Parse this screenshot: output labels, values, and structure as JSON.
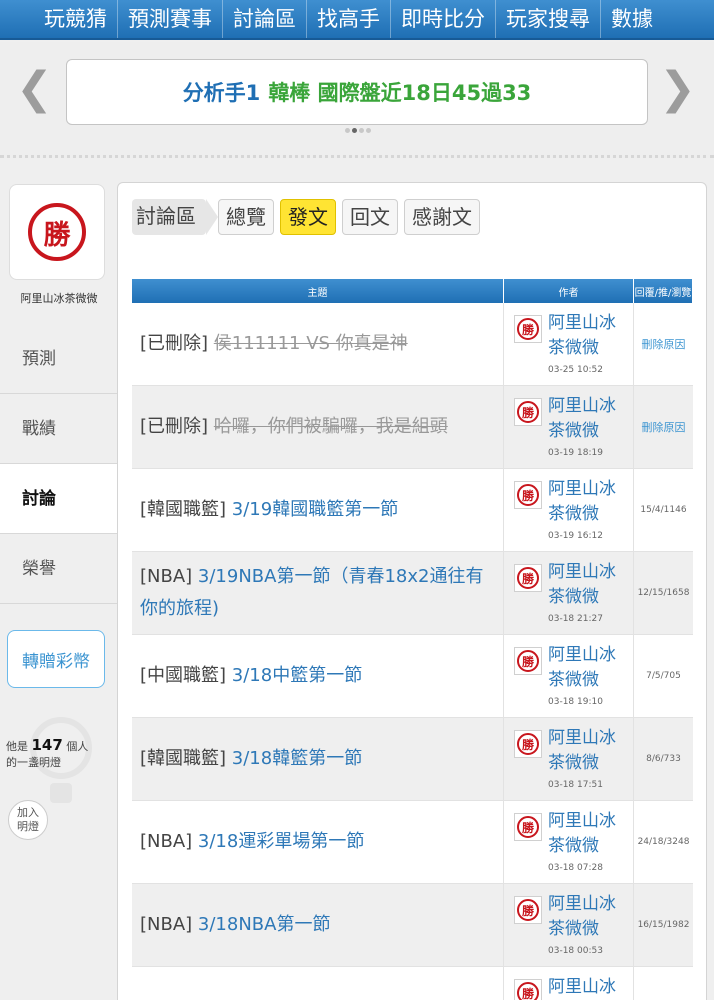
{
  "nav": [
    "玩競猜",
    "預測賽事",
    "討論區",
    "找高手",
    "即時比分",
    "玩家搜尋",
    "數據"
  ],
  "banner": {
    "prefix": "分析手1",
    "text": "韓棒 國際盤近18日45過33",
    "arrow_left": "❮",
    "arrow_right": "❯"
  },
  "sidebar": {
    "badge": "勝",
    "username": "阿里山冰茶微微",
    "items": [
      "預測",
      "戰績",
      "討論",
      "榮譽"
    ],
    "gift_button": "轉贈彩幣",
    "lamp_prefix": "他是",
    "lamp_count": "147",
    "lamp_suffix": "個人",
    "lamp_line2": "的一盞明燈",
    "join_line1": "加入",
    "join_line2": "明燈"
  },
  "tabs": {
    "crumb": "討論區",
    "items": [
      "總覽",
      "發文",
      "回文",
      "感謝文"
    ]
  },
  "table": {
    "headers": [
      "主題",
      "作者",
      "回覆/推/瀏覽"
    ],
    "rows": [
      {
        "cat": "[已刪除]",
        "title": "侯111111 VS 你真是神",
        "deleted": true,
        "author1": "阿里山冰",
        "author2": "茶微微",
        "date": "03-25 10:52",
        "stats": "刪除原因"
      },
      {
        "cat": "[已刪除]",
        "title": "哈囉，你們被騙囉，我是組頭",
        "deleted": true,
        "author1": "阿里山冰",
        "author2": "茶微微",
        "date": "03-19 18:19",
        "stats": "刪除原因"
      },
      {
        "cat": "[韓國職籃]",
        "title": "3/19韓國職籃第一節",
        "deleted": false,
        "author1": "阿里山冰",
        "author2": "茶微微",
        "date": "03-19 16:12",
        "stats": "15/4/1146"
      },
      {
        "cat": "[NBA]",
        "title": "3/19NBA第一節（青春18x2通往有你的旅程)",
        "deleted": false,
        "author1": "阿里山冰",
        "author2": "茶微微",
        "date": "03-18 21:27",
        "stats": "12/15/1658"
      },
      {
        "cat": "[中國職籃]",
        "title": "3/18中籃第一節",
        "deleted": false,
        "author1": "阿里山冰",
        "author2": "茶微微",
        "date": "03-18 19:10",
        "stats": "7/5/705"
      },
      {
        "cat": "[韓國職籃]",
        "title": "3/18韓籃第一節",
        "deleted": false,
        "author1": "阿里山冰",
        "author2": "茶微微",
        "date": "03-18 17:51",
        "stats": "8/6/733"
      },
      {
        "cat": "[NBA]",
        "title": "3/18運彩單場第一節",
        "deleted": false,
        "author1": "阿里山冰",
        "author2": "茶微微",
        "date": "03-18 07:28",
        "stats": "24/18/3248"
      },
      {
        "cat": "[NBA]",
        "title": "3/18NBA第一節",
        "deleted": false,
        "author1": "阿里山冰",
        "author2": "茶微微",
        "date": "03-18 00:53",
        "stats": "16/15/1982"
      },
      {
        "cat": "",
        "title": "",
        "deleted": false,
        "author1": "阿里山冰",
        "author2": "",
        "date": "",
        "stats": ""
      }
    ]
  }
}
